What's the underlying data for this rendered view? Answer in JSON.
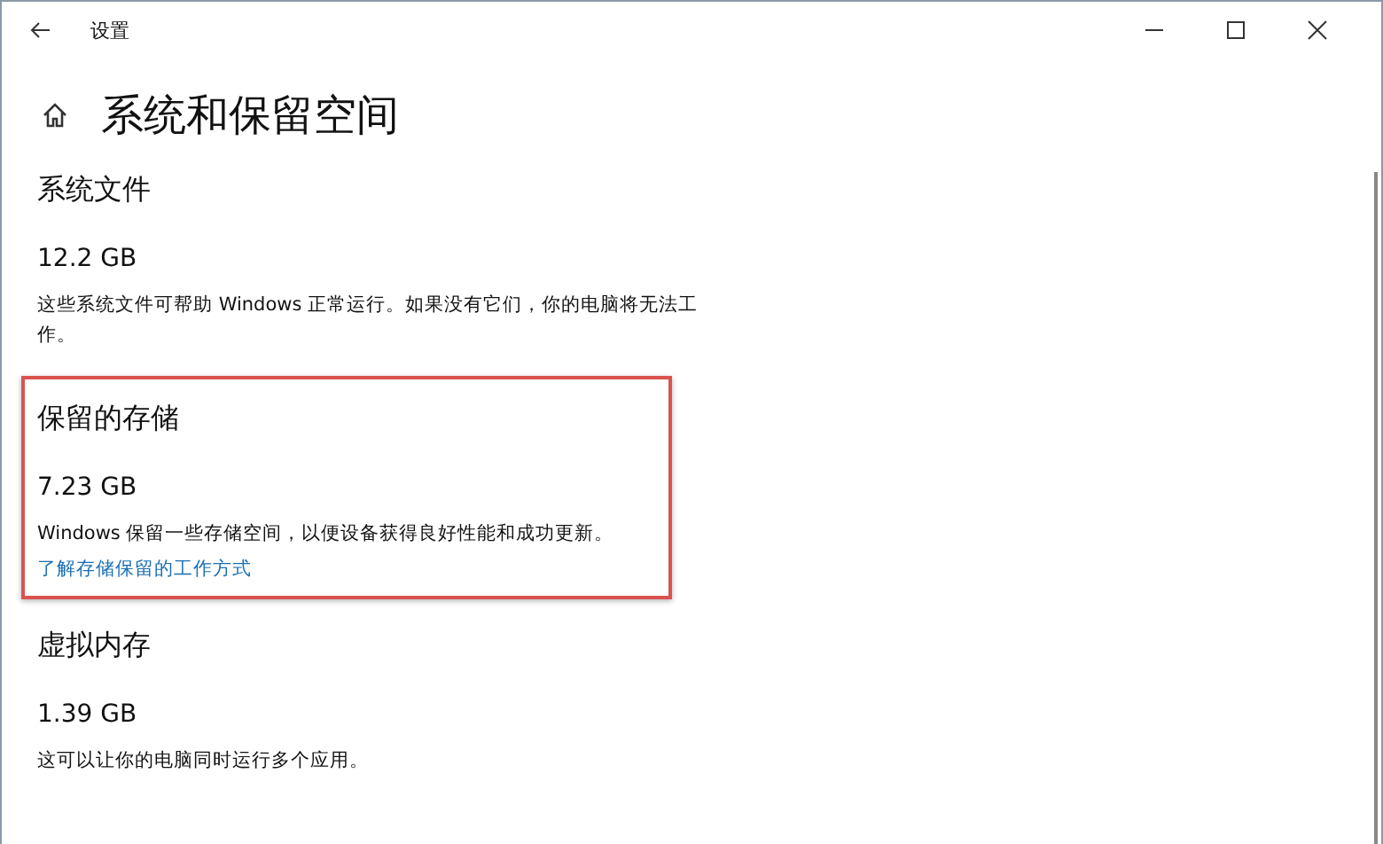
{
  "window": {
    "title": "设置"
  },
  "page_title": "系统和保留空间",
  "sections": [
    {
      "heading": "系统文件",
      "size": "12.2 GB",
      "description": "这些系统文件可帮助 Windows 正常运行。如果没有它们，你的电脑将无法工作。",
      "highlighted": false
    },
    {
      "heading": "保留的存储",
      "size": "7.23 GB",
      "description": "Windows 保留一些存储空间，以便设备获得良好性能和成功更新。",
      "link": "了解存储保留的工作方式",
      "highlighted": true
    },
    {
      "heading": "虚拟内存",
      "size": "1.39 GB",
      "description": "这可以让你的电脑同时运行多个应用。",
      "highlighted": false
    }
  ]
}
